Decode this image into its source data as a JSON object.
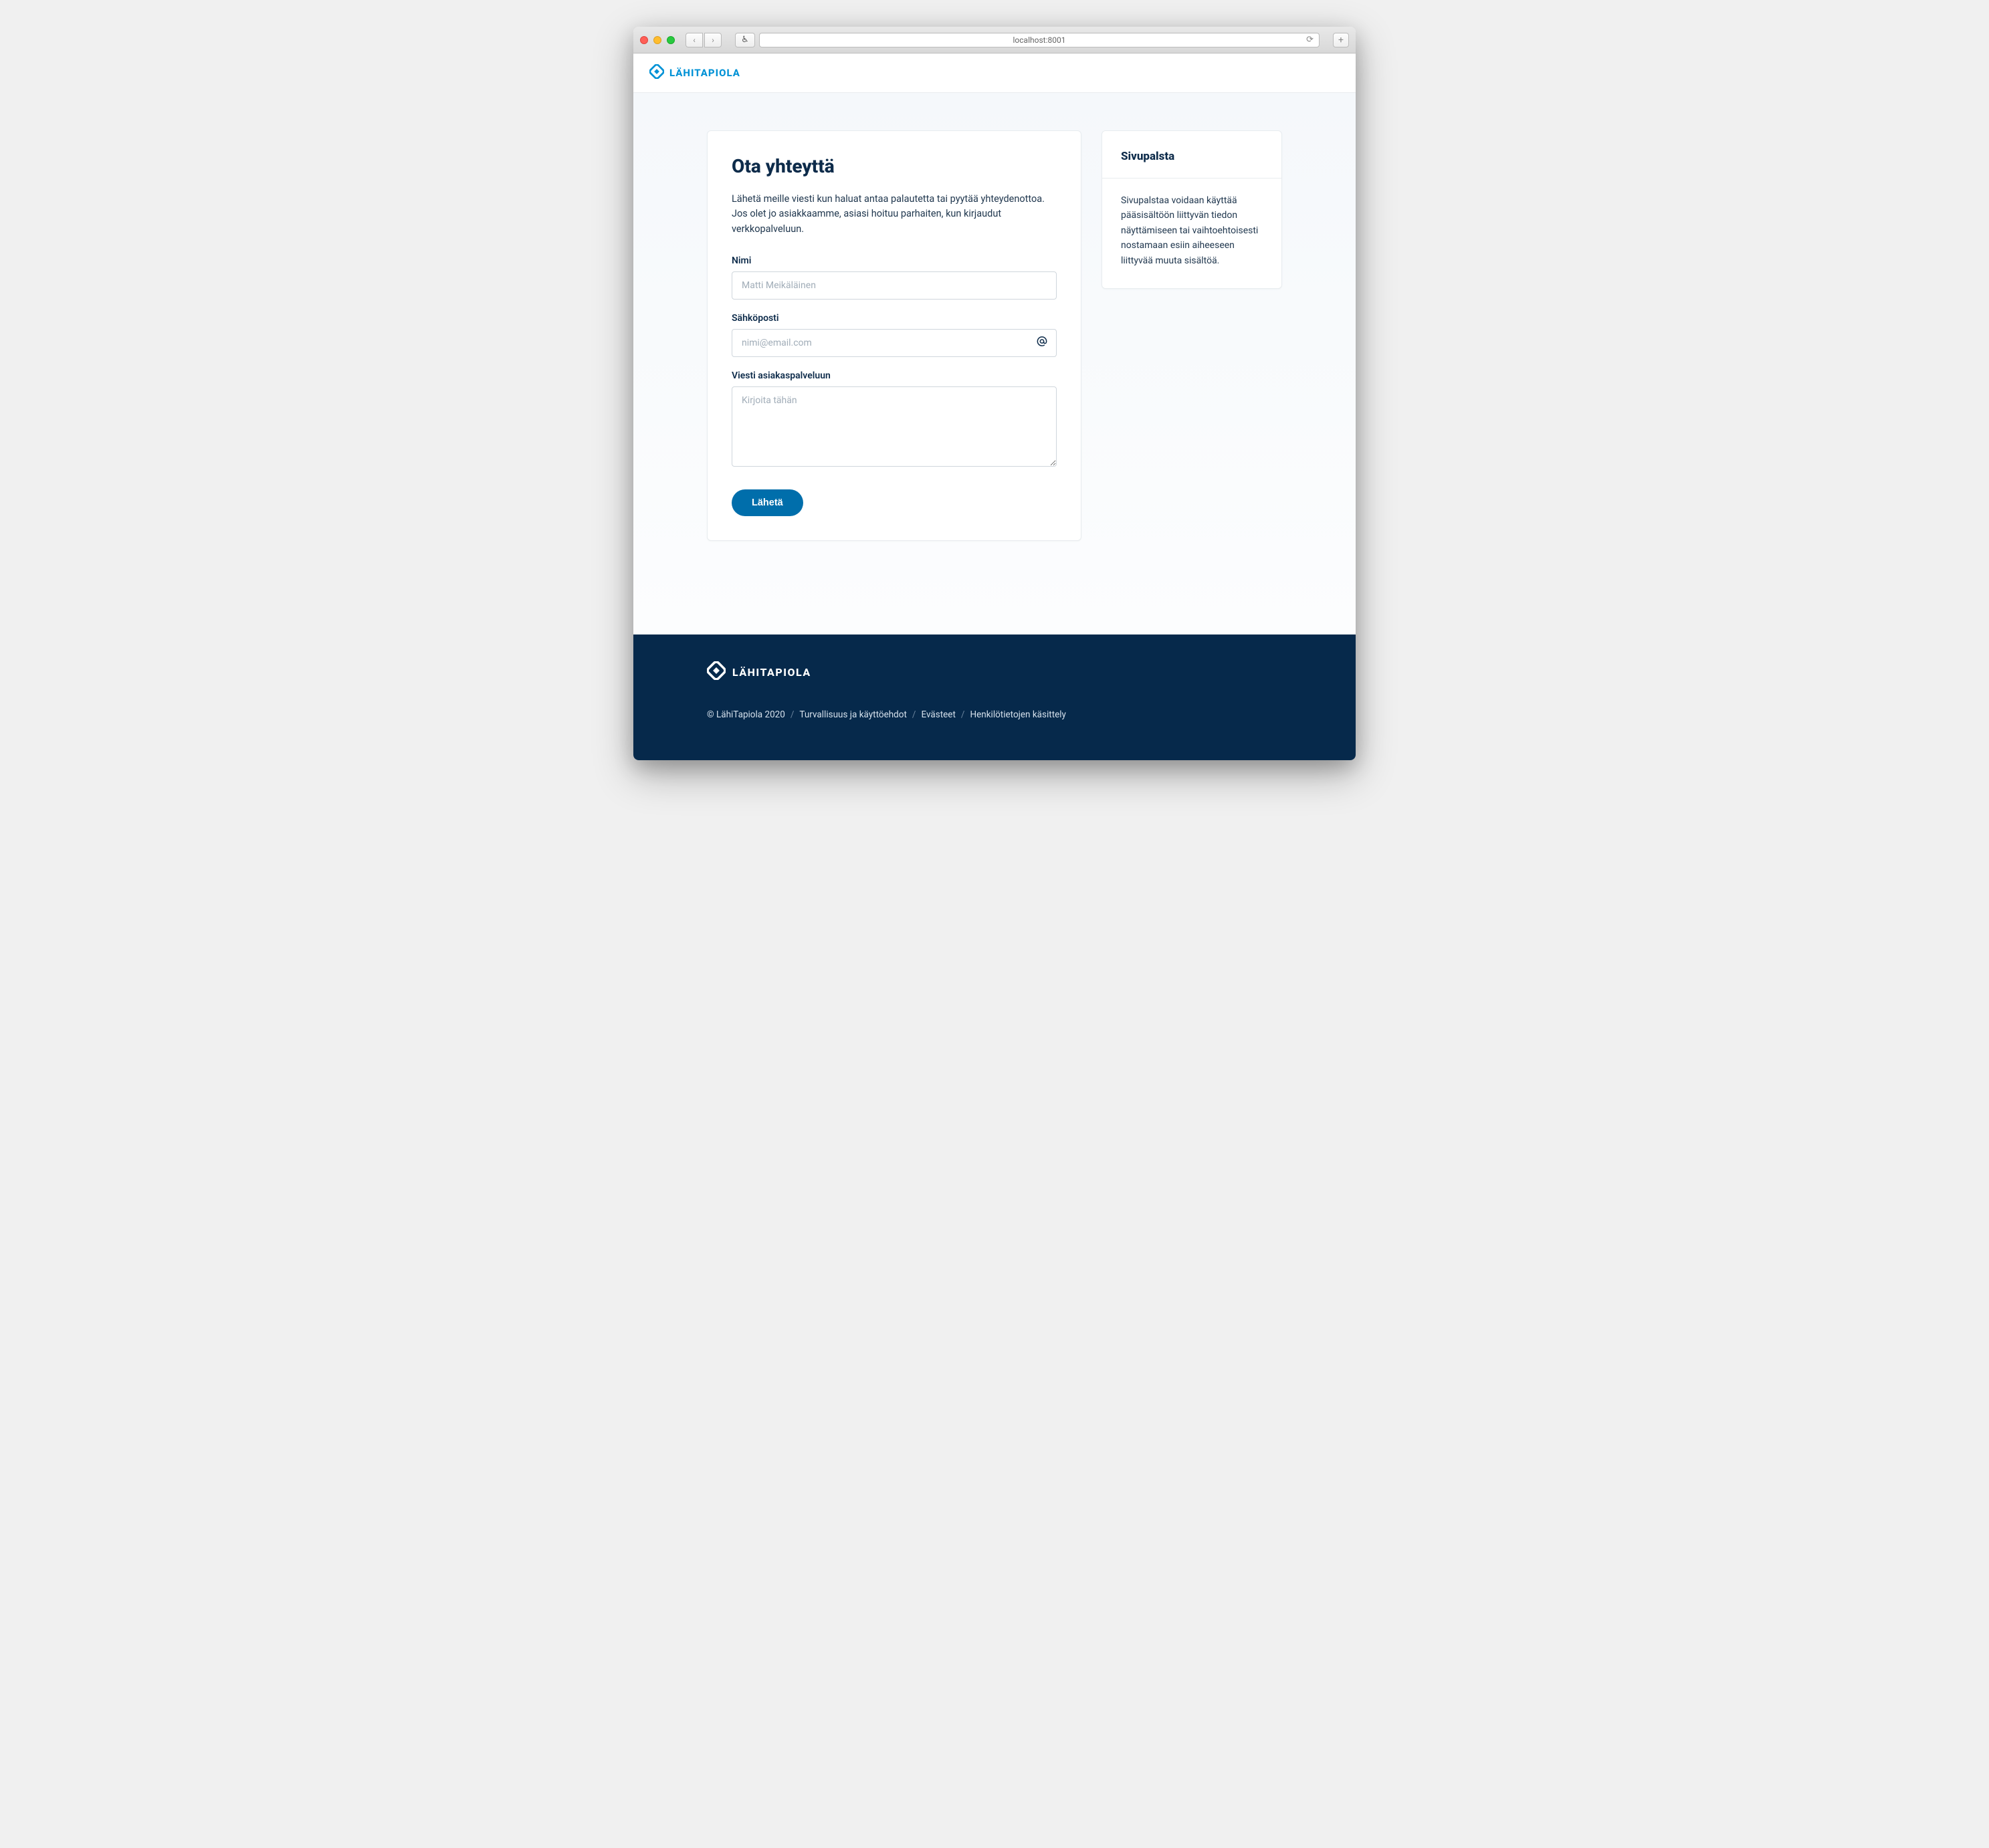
{
  "browser": {
    "address": "localhost:8001"
  },
  "brand": "LÄHITAPIOLA",
  "main": {
    "title": "Ota yhteyttä",
    "intro": "Lähetä meille viesti kun haluat antaa palautetta tai pyytää yhteydenottoa. Jos olet jo asiakkaamme, asiasi hoituu parhaiten, kun kirjaudut verkkopalveluun.",
    "fields": {
      "name": {
        "label": "Nimi",
        "placeholder": "Matti Meikäläinen",
        "value": ""
      },
      "email": {
        "label": "Sähköposti",
        "placeholder": "nimi@email.com",
        "value": ""
      },
      "message": {
        "label": "Viesti asiakaspalveluun",
        "placeholder": "Kirjoita tähän",
        "value": ""
      }
    },
    "submit": "Lähetä"
  },
  "sidebar": {
    "title": "Sivupalsta",
    "body": "Sivupalstaa voidaan käyttää pääsisältöön liittyvän tiedon näyttämiseen tai vaihtoehtoisesti nostamaan esiin aiheeseen liittyvää muuta sisältöä."
  },
  "footer": {
    "brand": "LÄHITAPIOLA",
    "copyright": "© LähiTapiola 2020",
    "links": [
      "Turvallisuus ja käyttöehdot",
      "Evästeet",
      "Henkilötietojen käsittely"
    ]
  }
}
